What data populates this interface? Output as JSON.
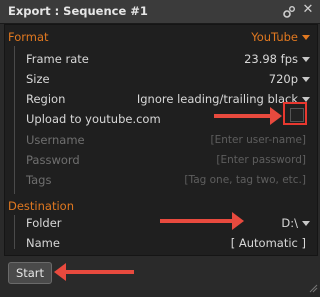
{
  "window": {
    "title": "Export : Sequence #1"
  },
  "format": {
    "label": "Format",
    "value": "YouTube",
    "rows": {
      "frame_rate": {
        "label": "Frame rate",
        "value": "23.98 fps"
      },
      "size": {
        "label": "Size",
        "value": "720p"
      },
      "region": {
        "label": "Region",
        "value": "Ignore leading/trailing black"
      },
      "upload": {
        "label": "Upload to youtube.com",
        "checked": false
      },
      "username": {
        "label": "Username",
        "placeholder": "[Enter user-name]"
      },
      "password": {
        "label": "Password",
        "placeholder": "[Enter password]"
      },
      "tags": {
        "label": "Tags",
        "placeholder": "[Tag one, tag two, etc.]"
      }
    }
  },
  "destination": {
    "label": "Destination",
    "rows": {
      "folder": {
        "label": "Folder",
        "value": "D:\\"
      },
      "name": {
        "label": "Name",
        "value": "[ Automatic ]"
      }
    }
  },
  "actions": {
    "start_label": "Start"
  },
  "colors": {
    "accent": "#e07820",
    "annotation": "#e84a3e"
  },
  "icons": {
    "settings": "gear-icon",
    "close": "close-icon"
  }
}
